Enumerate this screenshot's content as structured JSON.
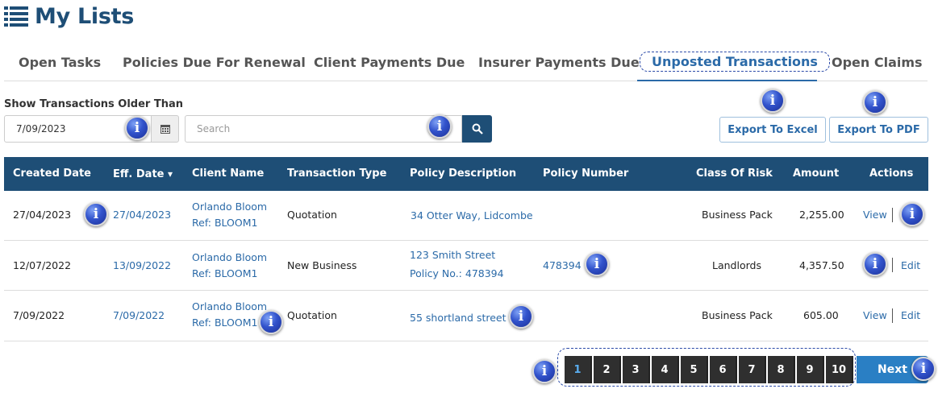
{
  "header": {
    "title": "My Lists",
    "icon": "list-icon"
  },
  "tabs": [
    {
      "label": "Open Tasks"
    },
    {
      "label": "Policies Due For Renewal"
    },
    {
      "label": "Client Payments Due"
    },
    {
      "label": "Insurer Payments Due"
    },
    {
      "label": "Unposted Transactions",
      "active": true
    },
    {
      "label": "Open Claims"
    }
  ],
  "filter": {
    "label": "Show Transactions Older Than",
    "date_value": "7/09/2023",
    "search_placeholder": "Search",
    "calendar_icon": "calendar-icon",
    "search_icon": "search-icon"
  },
  "exports": {
    "excel_label": "Export To Excel",
    "pdf_label": "Export To PDF"
  },
  "table": {
    "columns": [
      "Created Date",
      "Eff. Date",
      "Client Name",
      "Transaction Type",
      "Policy Description",
      "Policy Number",
      "Class Of Risk",
      "Amount",
      "Actions"
    ],
    "sort_indicator": "▾",
    "rows": [
      {
        "created": "27/04/2023",
        "eff": "27/04/2023",
        "client_name": "Orlando Bloom",
        "client_ref": "Ref: BLOOM1",
        "type": "Quotation",
        "policy_desc": "34 Otter Way, Lidcombe",
        "policy_desc2": "",
        "policy_number": "",
        "class": "Business Pack",
        "amount": "2,255.00",
        "action1": "View",
        "action2": ""
      },
      {
        "created": "12/07/2022",
        "eff": "13/09/2022",
        "client_name": "Orlando Bloom",
        "client_ref": "Ref: BLOOM1",
        "type": "New Business",
        "policy_desc": "123 Smith Street",
        "policy_desc2": "Policy No.: 478394",
        "policy_number": "478394",
        "class": "Landlords",
        "amount": "4,357.50",
        "action1": "",
        "action2": "Edit"
      },
      {
        "created": "7/09/2022",
        "eff": "7/09/2022",
        "client_name": "Orlando Bloom",
        "client_ref": "Ref: BLOOM1",
        "type": "Quotation",
        "policy_desc": "55 shortland street",
        "policy_desc2": "",
        "policy_number": "",
        "class": "Business Pack",
        "amount": "605.00",
        "action1": "View",
        "action2": "Edit"
      }
    ]
  },
  "pagination": {
    "pages": [
      "1",
      "2",
      "3",
      "4",
      "5",
      "6",
      "7",
      "8",
      "9",
      "10"
    ],
    "current": "1",
    "next_label": "Next"
  },
  "info_glyph": "i",
  "colors": {
    "primary": "#1e4e76",
    "link": "#2b6aa8",
    "next": "#2a7fc4",
    "pager": "#2f2f2f"
  }
}
